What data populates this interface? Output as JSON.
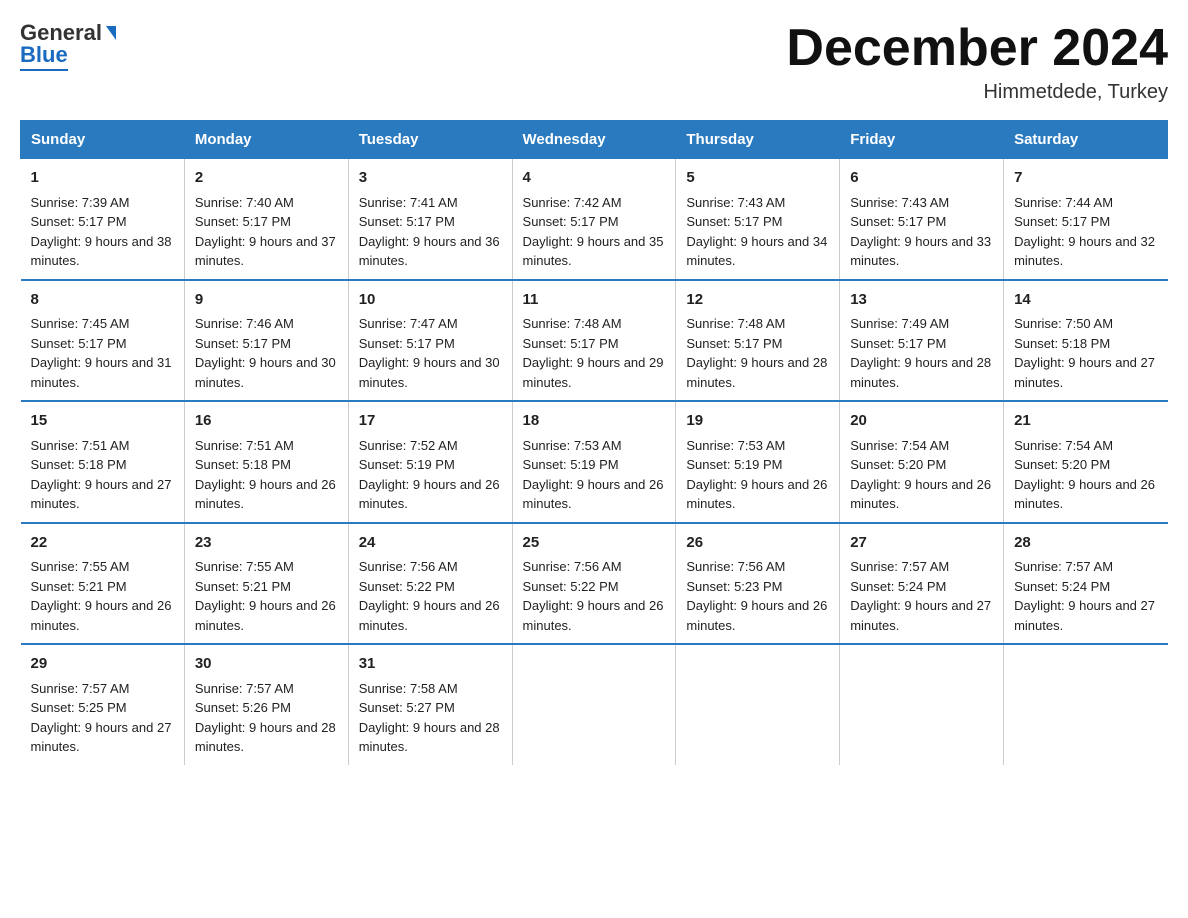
{
  "logo": {
    "general": "General",
    "arrow": "",
    "blue": "Blue"
  },
  "header": {
    "title": "December 2024",
    "location": "Himmetdede, Turkey"
  },
  "days": [
    "Sunday",
    "Monday",
    "Tuesday",
    "Wednesday",
    "Thursday",
    "Friday",
    "Saturday"
  ],
  "weeks": [
    [
      {
        "day": "1",
        "sunrise": "7:39 AM",
        "sunset": "5:17 PM",
        "daylight": "9 hours and 38 minutes."
      },
      {
        "day": "2",
        "sunrise": "7:40 AM",
        "sunset": "5:17 PM",
        "daylight": "9 hours and 37 minutes."
      },
      {
        "day": "3",
        "sunrise": "7:41 AM",
        "sunset": "5:17 PM",
        "daylight": "9 hours and 36 minutes."
      },
      {
        "day": "4",
        "sunrise": "7:42 AM",
        "sunset": "5:17 PM",
        "daylight": "9 hours and 35 minutes."
      },
      {
        "day": "5",
        "sunrise": "7:43 AM",
        "sunset": "5:17 PM",
        "daylight": "9 hours and 34 minutes."
      },
      {
        "day": "6",
        "sunrise": "7:43 AM",
        "sunset": "5:17 PM",
        "daylight": "9 hours and 33 minutes."
      },
      {
        "day": "7",
        "sunrise": "7:44 AM",
        "sunset": "5:17 PM",
        "daylight": "9 hours and 32 minutes."
      }
    ],
    [
      {
        "day": "8",
        "sunrise": "7:45 AM",
        "sunset": "5:17 PM",
        "daylight": "9 hours and 31 minutes."
      },
      {
        "day": "9",
        "sunrise": "7:46 AM",
        "sunset": "5:17 PM",
        "daylight": "9 hours and 30 minutes."
      },
      {
        "day": "10",
        "sunrise": "7:47 AM",
        "sunset": "5:17 PM",
        "daylight": "9 hours and 30 minutes."
      },
      {
        "day": "11",
        "sunrise": "7:48 AM",
        "sunset": "5:17 PM",
        "daylight": "9 hours and 29 minutes."
      },
      {
        "day": "12",
        "sunrise": "7:48 AM",
        "sunset": "5:17 PM",
        "daylight": "9 hours and 28 minutes."
      },
      {
        "day": "13",
        "sunrise": "7:49 AM",
        "sunset": "5:17 PM",
        "daylight": "9 hours and 28 minutes."
      },
      {
        "day": "14",
        "sunrise": "7:50 AM",
        "sunset": "5:18 PM",
        "daylight": "9 hours and 27 minutes."
      }
    ],
    [
      {
        "day": "15",
        "sunrise": "7:51 AM",
        "sunset": "5:18 PM",
        "daylight": "9 hours and 27 minutes."
      },
      {
        "day": "16",
        "sunrise": "7:51 AM",
        "sunset": "5:18 PM",
        "daylight": "9 hours and 26 minutes."
      },
      {
        "day": "17",
        "sunrise": "7:52 AM",
        "sunset": "5:19 PM",
        "daylight": "9 hours and 26 minutes."
      },
      {
        "day": "18",
        "sunrise": "7:53 AM",
        "sunset": "5:19 PM",
        "daylight": "9 hours and 26 minutes."
      },
      {
        "day": "19",
        "sunrise": "7:53 AM",
        "sunset": "5:19 PM",
        "daylight": "9 hours and 26 minutes."
      },
      {
        "day": "20",
        "sunrise": "7:54 AM",
        "sunset": "5:20 PM",
        "daylight": "9 hours and 26 minutes."
      },
      {
        "day": "21",
        "sunrise": "7:54 AM",
        "sunset": "5:20 PM",
        "daylight": "9 hours and 26 minutes."
      }
    ],
    [
      {
        "day": "22",
        "sunrise": "7:55 AM",
        "sunset": "5:21 PM",
        "daylight": "9 hours and 26 minutes."
      },
      {
        "day": "23",
        "sunrise": "7:55 AM",
        "sunset": "5:21 PM",
        "daylight": "9 hours and 26 minutes."
      },
      {
        "day": "24",
        "sunrise": "7:56 AM",
        "sunset": "5:22 PM",
        "daylight": "9 hours and 26 minutes."
      },
      {
        "day": "25",
        "sunrise": "7:56 AM",
        "sunset": "5:22 PM",
        "daylight": "9 hours and 26 minutes."
      },
      {
        "day": "26",
        "sunrise": "7:56 AM",
        "sunset": "5:23 PM",
        "daylight": "9 hours and 26 minutes."
      },
      {
        "day": "27",
        "sunrise": "7:57 AM",
        "sunset": "5:24 PM",
        "daylight": "9 hours and 27 minutes."
      },
      {
        "day": "28",
        "sunrise": "7:57 AM",
        "sunset": "5:24 PM",
        "daylight": "9 hours and 27 minutes."
      }
    ],
    [
      {
        "day": "29",
        "sunrise": "7:57 AM",
        "sunset": "5:25 PM",
        "daylight": "9 hours and 27 minutes."
      },
      {
        "day": "30",
        "sunrise": "7:57 AM",
        "sunset": "5:26 PM",
        "daylight": "9 hours and 28 minutes."
      },
      {
        "day": "31",
        "sunrise": "7:58 AM",
        "sunset": "5:27 PM",
        "daylight": "9 hours and 28 minutes."
      },
      null,
      null,
      null,
      null
    ]
  ]
}
